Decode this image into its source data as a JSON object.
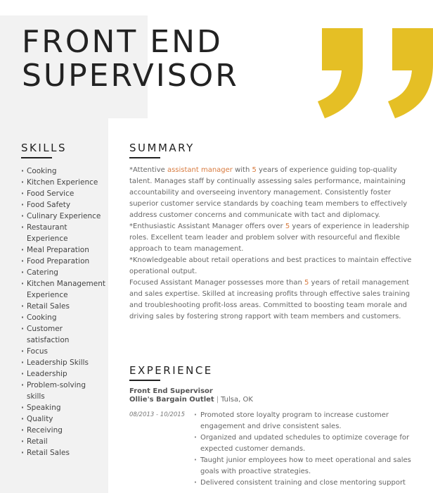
{
  "header": {
    "title_line1": "FRONT END",
    "title_line2": "SUPERVISOR",
    "accent_color": "#e5bf25",
    "icon": "closing-quote-icon"
  },
  "skills": {
    "heading": "SKILLS",
    "items": [
      "Cooking",
      "Kitchen Experience",
      "Food Service",
      "Food Safety",
      "Culinary Experience",
      "Restaurant Experience",
      "Meal Preparation",
      "Food Preparation",
      "Catering",
      "Kitchen Management Experience",
      "Retail Sales",
      "Cooking",
      "Customer satisfaction",
      "Focus",
      "Leadership Skills",
      "Leadership",
      "Problem-solving skills",
      "Speaking",
      "Quality",
      "Receiving",
      "Retail",
      "Retail Sales"
    ]
  },
  "summary": {
    "heading": "SUMMARY",
    "highlight_color": "#d87a3e",
    "p1_a": "*Attentive ",
    "p1_hl1": "assistant manager",
    "p1_b": " with ",
    "p1_hl2": "5",
    "p1_c": " years of experience guiding top-quality talent. Manages staff by continually assessing sales performance, maintaining accountability and overseeing inventory management. Consistently foster superior customer service standards by coaching team members to effectively address customer concerns and communicate with tact and diplomacy.",
    "p2_a": "*Enthusiastic Assistant Manager offers over ",
    "p2_hl": "5",
    "p2_b": " years of experience in leadership roles. Excellent team leader and problem solver with resourceful and flexible approach to team management.",
    "p3": "*Knowledgeable about retail operations and best practices to maintain effective operational output.",
    "p4_a": "Focused Assistant Manager possesses more than ",
    "p4_hl": "5",
    "p4_b": " years of retail management and sales expertise. Skilled at increasing profits through effective sales training and troubleshooting profit-loss areas. Committed to boosting team morale and driving sales by fostering strong rapport with team members and customers."
  },
  "experience": {
    "heading": "EXPERIENCE",
    "jobs": [
      {
        "title": "Front End Supervisor",
        "company": "Ollie's Bargain Outlet",
        "separator": "|",
        "location": "Tulsa, OK",
        "dates": "08/2013 - 10/2015",
        "bullets": [
          "Promoted store loyalty program to increase customer engagement and drive consistent sales.",
          "Organized and updated schedules to optimize coverage for expected customer demands.",
          "Taught junior employees how to meet operational and sales goals with proactive strategies.",
          "Delivered consistent training and close mentoring support"
        ]
      }
    ]
  }
}
